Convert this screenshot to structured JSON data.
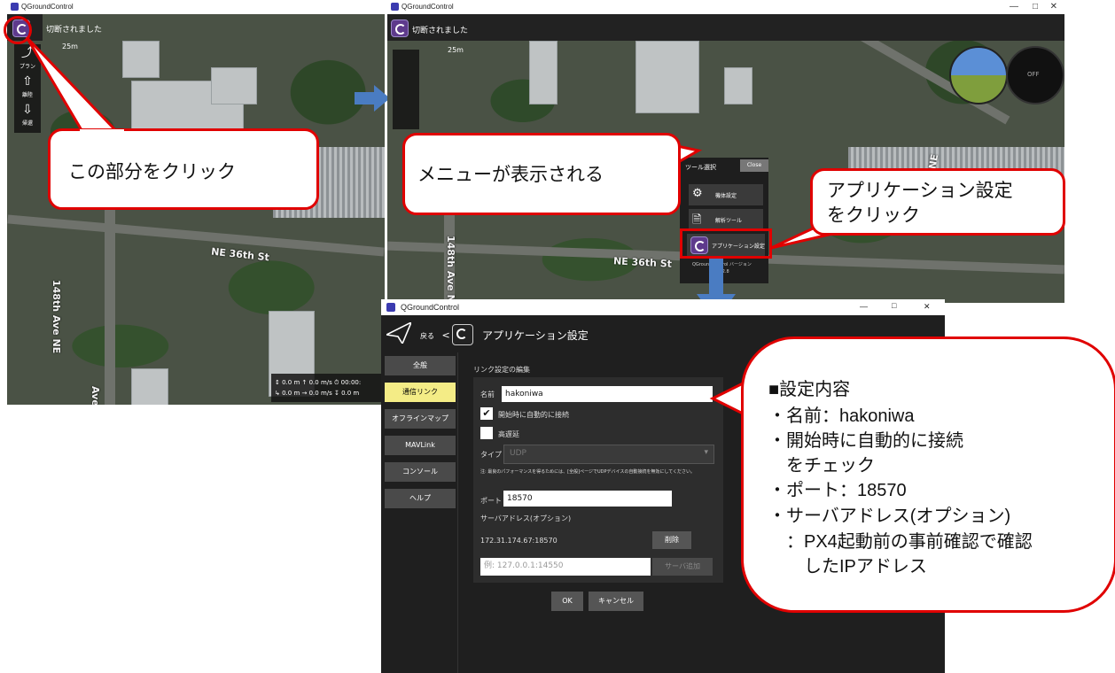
{
  "window_left": {
    "title": "QGroundControl",
    "status": "切断されました",
    "scale": "25m",
    "street_ne36": "NE 36th St",
    "street_148th": "148th Ave NE",
    "street_ave_ne": "Ave NE",
    "tools": [
      "プラン",
      "離陸",
      "帰還"
    ],
    "telemetry_line1": "↕ 0.0 m  ↑ 0.0 m/s  ⏱ 00:00:",
    "telemetry_line2": "↳ 0.0 m  → 0.0 m/s  ↧ 0.0 m"
  },
  "window_right": {
    "title": "QGroundControl",
    "status": "切断されました",
    "scale": "25m",
    "street_ne36": "NE 36th St",
    "street_148th": "148th Ave NE",
    "street_ne": "NE",
    "instrument_text": "OFF",
    "tool_menu": {
      "title": "ツール選択",
      "close": "Close",
      "items": [
        "機体設定",
        "解析ツール",
        "アプリケーション設定"
      ],
      "version_text": "QGroundControl バージョン",
      "version_num": "v4.2.8"
    }
  },
  "callouts": {
    "click_here": "この部分をクリック",
    "menu_shown": "メニューが表示される",
    "click_app_settings_1": "アプリケーション設定",
    "click_app_settings_2": "をクリック",
    "settings_heading": "■設定内容",
    "settings_lines": [
      "・名前：hakoniwa",
      "・開始時に自動的に接続",
      "　をチェック",
      "・ポート：18570",
      "・サーバアドレス(オプション)",
      "　：PX4起動前の事前確認で確認",
      "　　したIPアドレス"
    ]
  },
  "dialog": {
    "title": "QGroundControl",
    "back": "戻る",
    "back_arrow": "<",
    "heading": "アプリケーション設定",
    "nav": [
      "全般",
      "通信リンク",
      "オフラインマップ",
      "MAVLink",
      "コンソール",
      "ヘルプ"
    ],
    "active_nav": "通信リンク",
    "section_title": "リンク設定の編集",
    "name_label": "名前",
    "name_value": "hakoniwa",
    "autoconnect_label": "開始時に自動的に接続",
    "highlatency_label": "高遅延",
    "type_label": "タイプ",
    "type_value": "UDP",
    "note": "注: 最良のパフォーマンスを得るためには、[全般]ページでUDPデバイスの自動接続を無効にしてください。",
    "port_label": "ポート",
    "port_value": "18570",
    "server_label": "サーバアドレス(オプション)",
    "server_value": "172.31.174.67:18570",
    "delete_button": "削除",
    "server_placeholder": "例: 127.0.0.1:14550",
    "add_server_button": "サーバ追加",
    "ok_button": "OK",
    "cancel_button": "キャンセル",
    "win_min": "—",
    "win_max": "□",
    "win_close": "✕"
  },
  "colors": {
    "callout_border": "#e00000",
    "arrow": "#4a7cc2",
    "active_nav": "#f4ec86"
  }
}
